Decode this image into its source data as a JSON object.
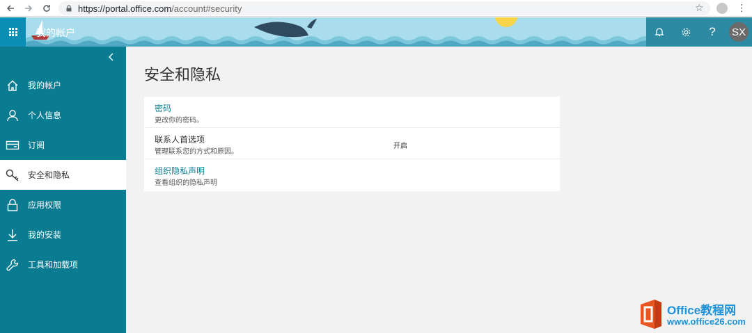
{
  "browser": {
    "url_host": "https://portal.office.com",
    "url_path": "/account#security"
  },
  "header": {
    "title": "我的帐户",
    "avatar_initials": "SX",
    "theme_color": "#9fd7e8",
    "accent_color": "#0a7c92"
  },
  "sidebar": {
    "items": [
      {
        "label": "我的帐户",
        "icon": "home-icon"
      },
      {
        "label": "个人信息",
        "icon": "person-icon"
      },
      {
        "label": "订阅",
        "icon": "card-icon"
      },
      {
        "label": "安全和隐私",
        "icon": "key-icon",
        "active": true
      },
      {
        "label": "应用权限",
        "icon": "lock-icon"
      },
      {
        "label": "我的安装",
        "icon": "download-icon"
      },
      {
        "label": "工具和加载项",
        "icon": "wrench-icon"
      }
    ]
  },
  "main": {
    "title": "安全和隐私",
    "rows": [
      {
        "title": "密码",
        "desc": "更改你的密码。",
        "status": ""
      },
      {
        "title": "联系人首选项",
        "desc": "管理联系您的方式和原因。",
        "status": "开启"
      },
      {
        "title": "组织隐私声明",
        "desc": "查看组织的隐私声明",
        "status": ""
      }
    ]
  },
  "watermark": {
    "brand": "Office教程网",
    "url": "www.office26.com"
  }
}
